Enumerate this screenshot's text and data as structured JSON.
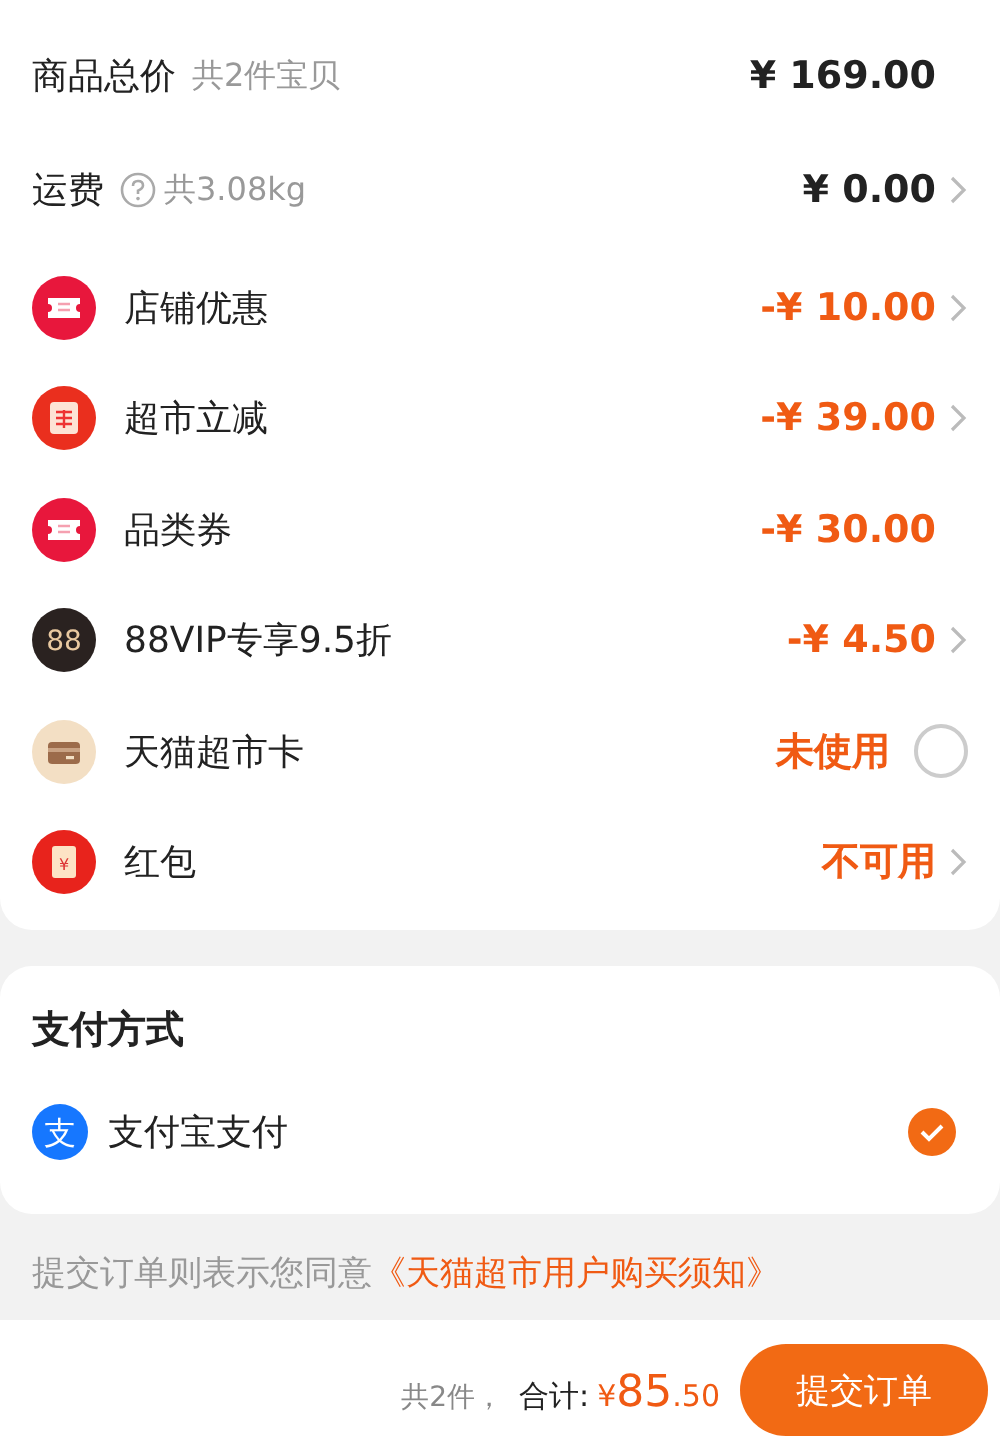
{
  "summary": {
    "total": {
      "label": "商品总价",
      "note": "共2件宝贝",
      "value": "¥ 169.00",
      "chevron": false
    },
    "shipping": {
      "label": "运费",
      "note": "共3.08kg",
      "value": "¥ 0.00",
      "chevron": true
    },
    "benefits": [
      {
        "kind": "coupon",
        "label": "店铺优惠",
        "value": "-¥ 10.00",
        "chevron": true
      },
      {
        "kind": "instant",
        "label": "超市立减",
        "value": "-¥ 39.00",
        "chevron": true
      },
      {
        "kind": "coupon",
        "label": "品类券",
        "value": "-¥ 30.00",
        "chevron": false
      },
      {
        "kind": "vip",
        "label": "88VIP专享9.5折",
        "icon_text": "88",
        "value": "-¥ 4.50",
        "chevron": true
      },
      {
        "kind": "card",
        "label": "天猫超市卡",
        "value": "未使用",
        "checked": false
      },
      {
        "kind": "redpacket",
        "label": "红包",
        "icon_text": "¥",
        "value": "不可用",
        "chevron": true
      }
    ]
  },
  "payment": {
    "title": "支付方式",
    "methods": [
      {
        "label": "支付宝支付",
        "icon_text": "支",
        "selected": true
      }
    ]
  },
  "agreement": {
    "text": "提交订单则表示您同意",
    "link": "《天猫超市用户购买须知》"
  },
  "footer": {
    "count": "共2件，",
    "total_label": "合计:",
    "currency": "¥",
    "amount_main": "85",
    "amount_fraction": ".50",
    "submit": "提交订单"
  }
}
